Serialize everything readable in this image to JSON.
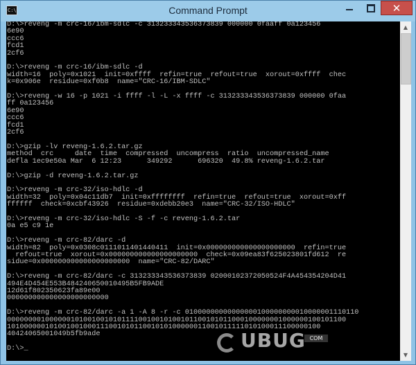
{
  "window": {
    "title": "Command Prompt",
    "app_icon_text": "C:\\",
    "controls": {
      "minimize": "",
      "maximize": "",
      "close": "✕"
    }
  },
  "console": {
    "text": "D:\\>reveng -m crc-16/ibm-sdlc -c 313233343536373839 000000 0faaff 0a123456\n6e90\nccc6\nfcd1\n2cf6\n\nD:\\>reveng -m crc-16/ibm-sdlc -d\nwidth=16  poly=0x1021  init=0xffff  refin=true  refout=true  xorout=0xffff  chec\nk=0x906e  residue=0xf0b8  name=\"CRC-16/IBM-SDLC\"\n\nD:\\>reveng -w 16 -p 1021 -i ffff -l -L -x ffff -c 313233343536373839 000000 0faa\nff 0a123456\n6e90\nccc6\nfcd1\n2cf6\n\nD:\\>gzip -lv reveng-1.6.2.tar.gz\nmethod  crc     date  time  compressed  uncompress  ratio  uncompressed_name\ndefla 1ec9e50a Mar  6 12:23      349292      696320  49.8% reveng-1.6.2.tar\n\nD:\\>gzip -d reveng-1.6.2.tar.gz\n\nD:\\>reveng -m crc-32/iso-hdlc -d\nwidth=32  poly=0x04c11db7  init=0xffffffff  refin=true  refout=true  xorout=0xff\nffffff  check=0xcbf43926  residue=0xdebb20e3  name=\"CRC-32/ISO-HDLC\"\n\nD:\\>reveng -m crc-32/iso-hdlc -S -f -c reveng-1.6.2.tar\n0a e5 c9 1e\n\nD:\\>reveng -m crc-82/darc -d\nwidth=82  poly=0x0308c0111011401440411  init=0x000000000000000000000  refin=true\n  refout=true  xorout=0x000000000000000000000  check=0x09ea83f625023801fd612  re\nsidue=0x000000000000000000000  name=\"CRC-82/DARC\"\n\nD:\\>reveng -m crc-82/darc -c 313233343536373839 02000102372050524F4A454354204D41\n494E4D454E553B484240650010495B5FB9ADE\n12d61f802350623fa89e00\n000000000000000000000000\n\nD:\\>reveng -m crc-82/darc -a 1 -A 8 -r -c 01000000000000000100000000010000001110110\n00000000100000010100100101011110010010100101100101011000100000001000000100101100\n10100000010100100100011100101011001010100000011001011111010100011100000100\n40424065001049b5fb9ade\n\nD:\\>",
    "cursor": "_"
  },
  "watermark": {
    "text": "UBUG",
    "badge": "COM"
  }
}
